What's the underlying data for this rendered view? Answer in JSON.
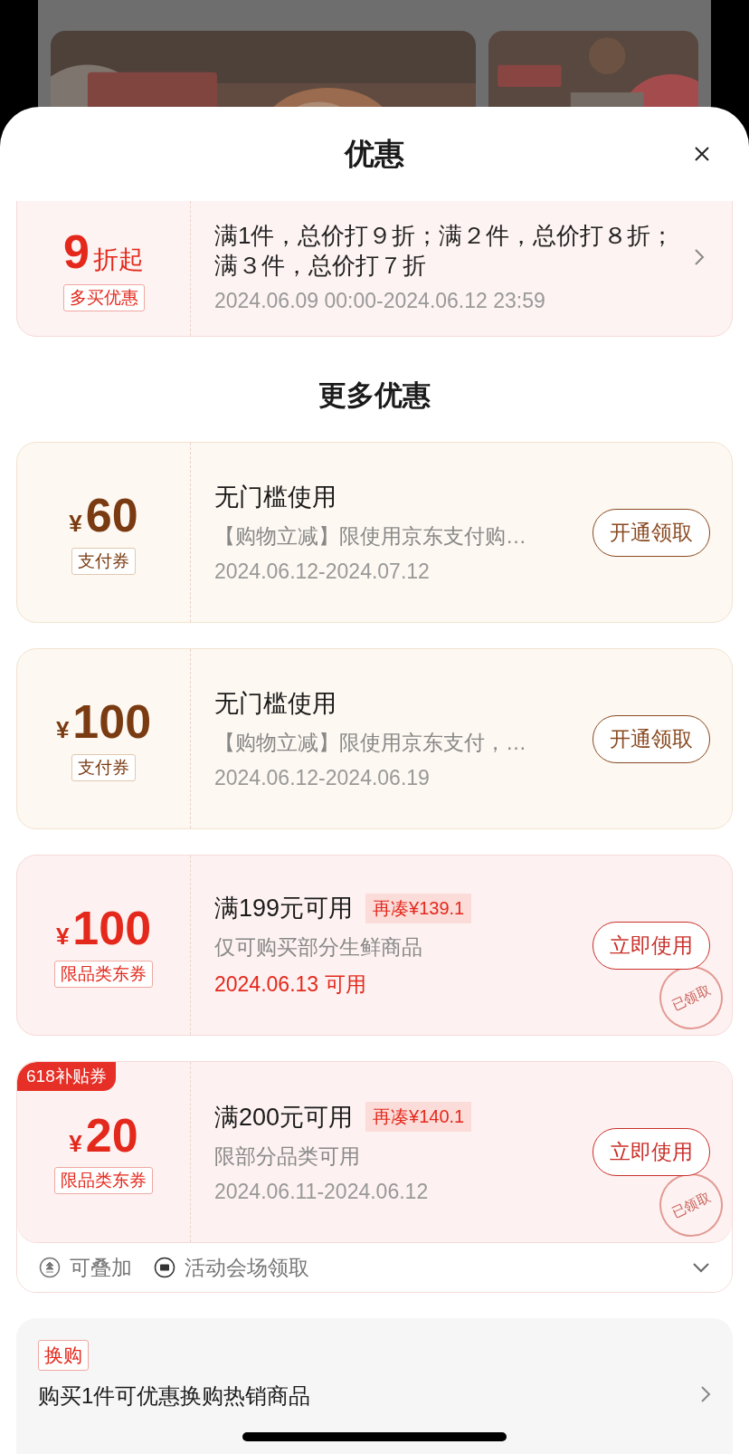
{
  "sheet": {
    "title": "优惠"
  },
  "multi_buy": {
    "value": "9",
    "unit": "折起",
    "tag": "多买优惠",
    "description": "满1件，总价打９折；满２件，总价打８折；满３件，总价打７折",
    "period": "2024.06.09 00:00-2024.06.12 23:59"
  },
  "section_title": "更多优惠",
  "coupons": [
    {
      "kind": "pay",
      "currency": "¥",
      "amount": "60",
      "tag": "支付券",
      "title": "无门槛使用",
      "detail": "【购物立减】限使用京东支付购…",
      "period": "2024.06.12-2024.07.12",
      "period_highlight": false,
      "button": "开通领取"
    },
    {
      "kind": "pay",
      "currency": "¥",
      "amount": "100",
      "tag": "支付券",
      "title": "无门槛使用",
      "detail": "【购物立减】限使用京东支付，…",
      "period": "2024.06.12-2024.06.19",
      "period_highlight": false,
      "button": "开通领取"
    },
    {
      "kind": "category",
      "currency": "¥",
      "amount": "100",
      "tag": "限品类东券",
      "title": "满199元可用",
      "extra": "再凑¥139.1",
      "detail": "仅可购买部分生鲜商品",
      "period": "2024.06.13 可用",
      "period_highlight": true,
      "button": "立即使用",
      "stamp": "已领取"
    },
    {
      "kind": "category",
      "badge": "618补贴券",
      "currency": "¥",
      "amount": "20",
      "tag": "限品类东券",
      "title": "满200元可用",
      "extra": "再凑¥140.1",
      "detail": "限部分品类可用",
      "period": "2024.06.11-2024.06.12",
      "period_highlight": false,
      "button": "立即使用",
      "stamp": "已领取"
    }
  ],
  "coupon_footer": {
    "features": [
      {
        "kind": "stack",
        "label": "可叠加"
      },
      {
        "kind": "ticket",
        "label": "活动会场领取"
      }
    ],
    "expanded": false
  },
  "swap": {
    "tag": "换购",
    "text": "购买1件可优惠换购热销商品"
  }
}
